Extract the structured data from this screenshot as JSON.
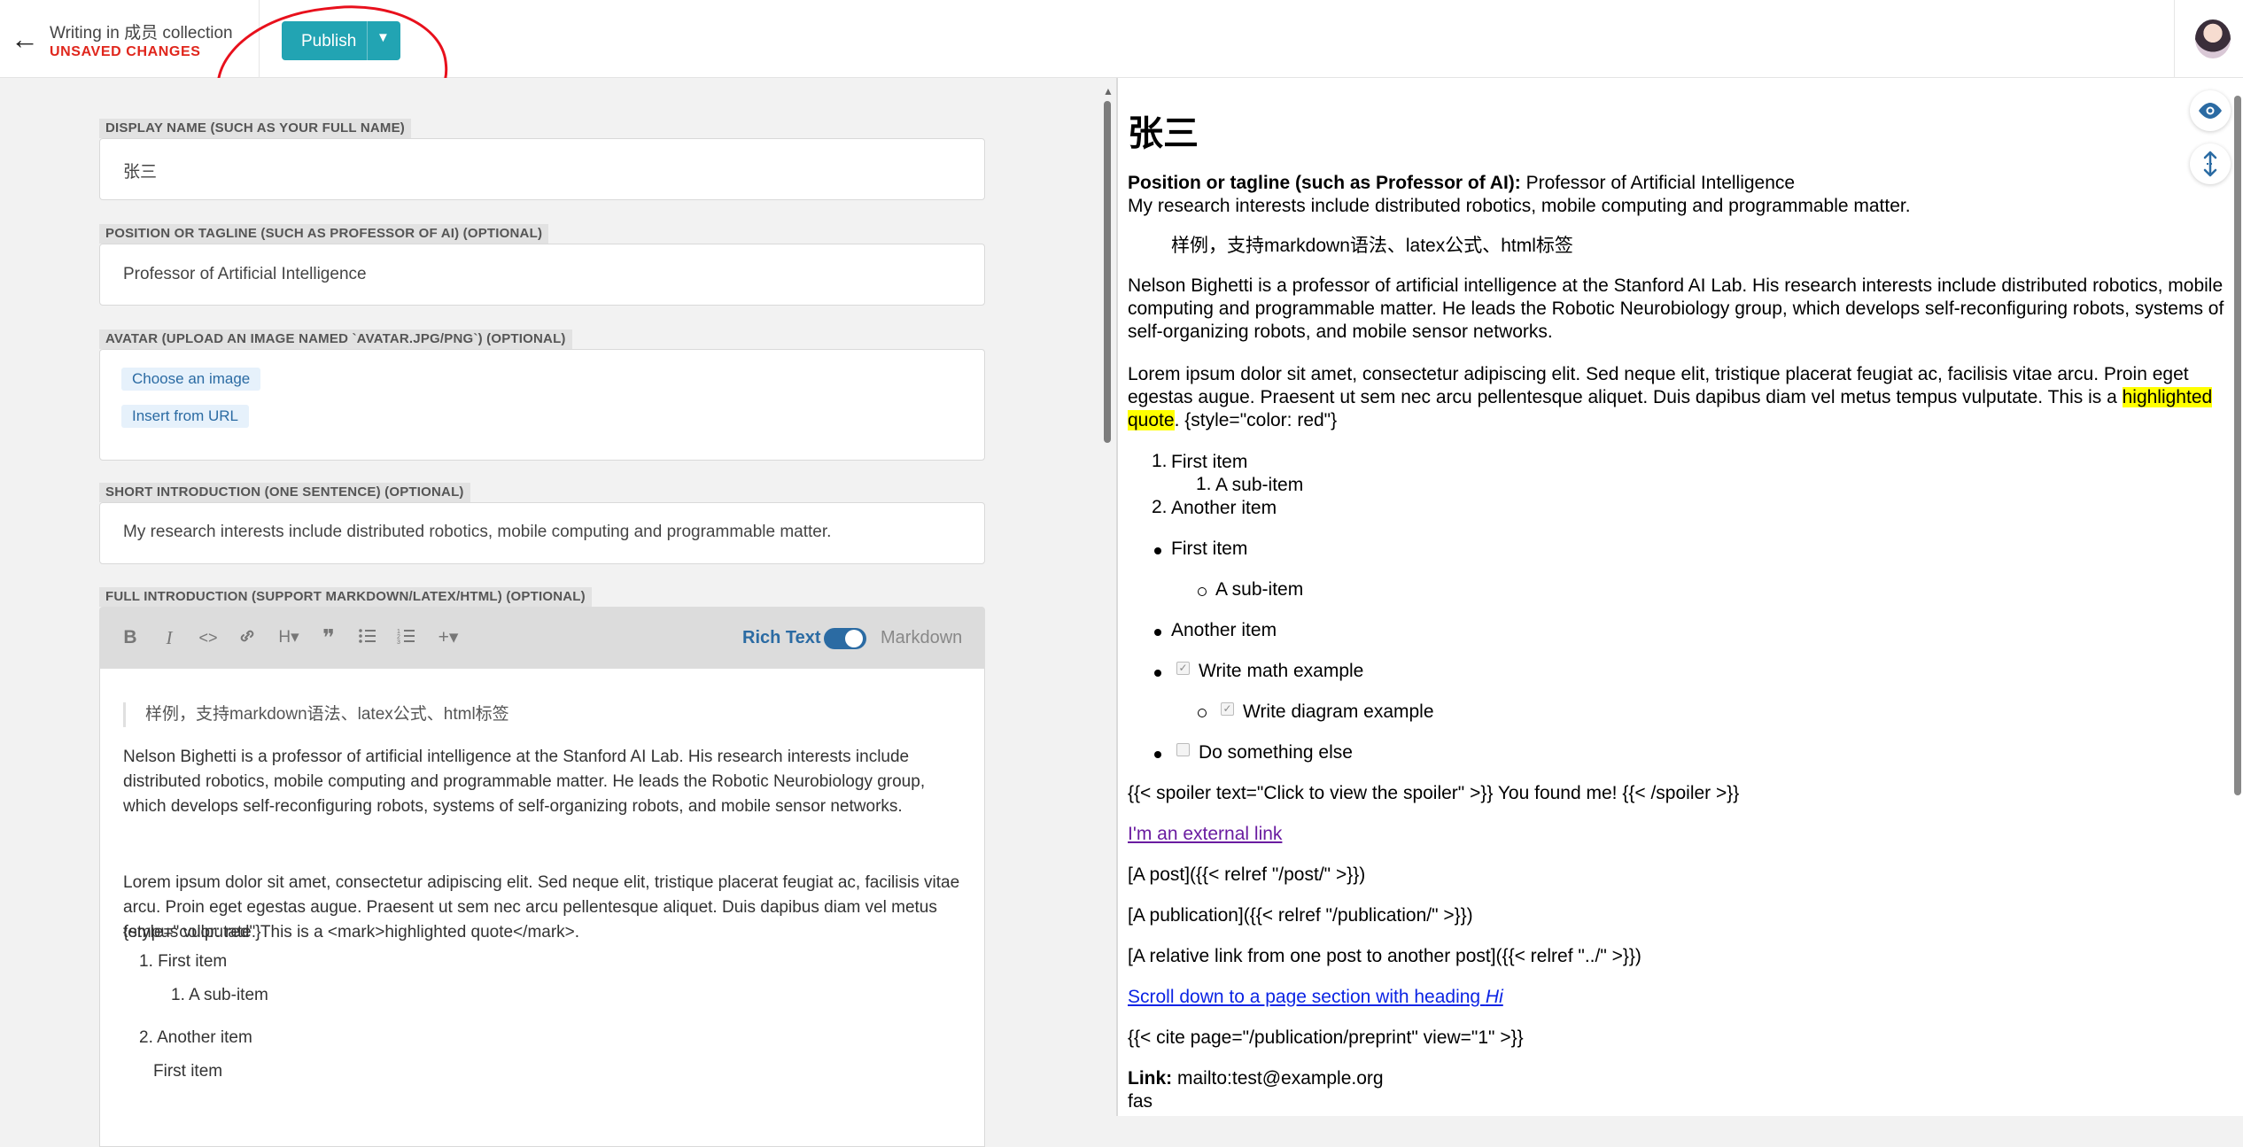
{
  "header": {
    "collection_text": "Writing in 成员 collection",
    "status": "UNSAVED CHANGES",
    "publish_label": "Publish"
  },
  "form": {
    "display_name": {
      "label": "DISPLAY NAME (SUCH AS YOUR FULL NAME)",
      "value": "张三"
    },
    "position": {
      "label": "POSITION OR TAGLINE (SUCH AS PROFESSOR OF AI) (OPTIONAL)",
      "value": "Professor of Artificial Intelligence"
    },
    "avatar": {
      "label": "AVATAR (UPLOAD AN IMAGE NAMED `AVATAR.JPG/PNG`) (OPTIONAL)",
      "choose": "Choose an image",
      "insert": "Insert from URL"
    },
    "short_intro": {
      "label": "SHORT INTRODUCTION (ONE SENTENCE) (OPTIONAL)",
      "value": "My research interests include distributed robotics, mobile computing and programmable matter."
    },
    "full_intro": {
      "label": "FULL INTRODUCTION (SUPPORT MARKDOWN/LATEX/HTML) (OPTIONAL)",
      "mode_rich": "Rich Text",
      "mode_markdown": "Markdown",
      "toolbar": {
        "bold": "B",
        "italic": "I",
        "code": "<>",
        "heading": "H▾",
        "quote": "❞",
        "add": "+▾"
      },
      "quote": "样例，支持markdown语法、latex公式、html标签",
      "para1": "Nelson Bighetti is a professor of artificial intelligence at the Stanford AI Lab. His research interests include distributed robotics, mobile computing and programmable matter. He leads the Robotic Neurobiology group, which develops self-reconfiguring robots, systems of self-organizing robots, and mobile sensor networks.",
      "para2": "Lorem ipsum dolor sit amet, consectetur adipiscing elit. Sed neque elit, tristique placerat feugiat ac, facilisis vitae arcu. Proin eget egestas augue. Praesent ut sem nec arcu pellentesque aliquet. Duis dapibus diam vel metus tempus vulputate. This is a <mark>highlighted quote</mark>.",
      "para2_style": "{style=\"color: red\"}",
      "list": [
        "1. First item",
        "1. A sub-item",
        "2. Another item",
        "First item"
      ]
    }
  },
  "preview": {
    "title": "张三",
    "position_label": "Position or tagline (such as Professor of AI):",
    "position_value": " Professor of Artificial Intelligence",
    "short_intro": "My research interests include distributed robotics, mobile computing and programmable matter.",
    "quote": "样例，支持markdown语法、latex公式、html标签",
    "para1": "Nelson Bighetti is a professor of artificial intelligence at the Stanford AI Lab. His research interests include distributed robotics, mobile computing and programmable matter. He leads the Robotic Neurobiology group, which develops self-reconfiguring robots, systems of self-organizing robots, and mobile sensor networks.",
    "para2_a": "Lorem ipsum dolor sit amet, consectetur adipiscing elit. Sed neque elit, tristique placerat feugiat ac, facilisis vitae arcu. Proin eget egestas augue. Praesent ut sem nec arcu pellentesque aliquet. Duis dapibus diam vel metus tempus vulputate. This is a ",
    "para2_hl": "highlighted quote",
    "para2_b": ". {style=\"color: red\"}",
    "ol": {
      "n1": "1.",
      "item1": "First item",
      "n2": "1.",
      "sub": "A sub-item",
      "n3": "2.",
      "item2": "Another item"
    },
    "ul": {
      "item1": "First item",
      "sub": "A sub-item",
      "item2": "Another item"
    },
    "tasks": {
      "t1": "Write math example",
      "t2": "Write diagram example",
      "t3": "Do something else"
    },
    "spoiler": "{{< spoiler text=\"Click to view the spoiler\" >}} You found me! {{< /spoiler >}}",
    "external_link": "I'm an external link",
    "post_ref": "[A post]({{< relref \"/post/\" >}})",
    "pub_ref": "[A publication]({{< relref \"/publication/\" >}})",
    "rel_ref": "[A relative link from one post to another post]({{< relref \"../\" >}})",
    "scroll_link": "Scroll down to a page section with heading ",
    "scroll_link_em": "Hi",
    "cite": "{{< cite page=\"/publication/preprint\" view=\"1\" >}}",
    "link_label": "Link:",
    "link_value": " mailto:test@example.org",
    "fas": "fas"
  },
  "colors": {
    "publish": "#22a4b3",
    "unsaved": "#e0261c",
    "annotation": "#e8101c",
    "accent": "#2b6ba3",
    "highlight": "#ffff00",
    "link": "#0b24e4",
    "visited_link": "#6a1ca0"
  }
}
